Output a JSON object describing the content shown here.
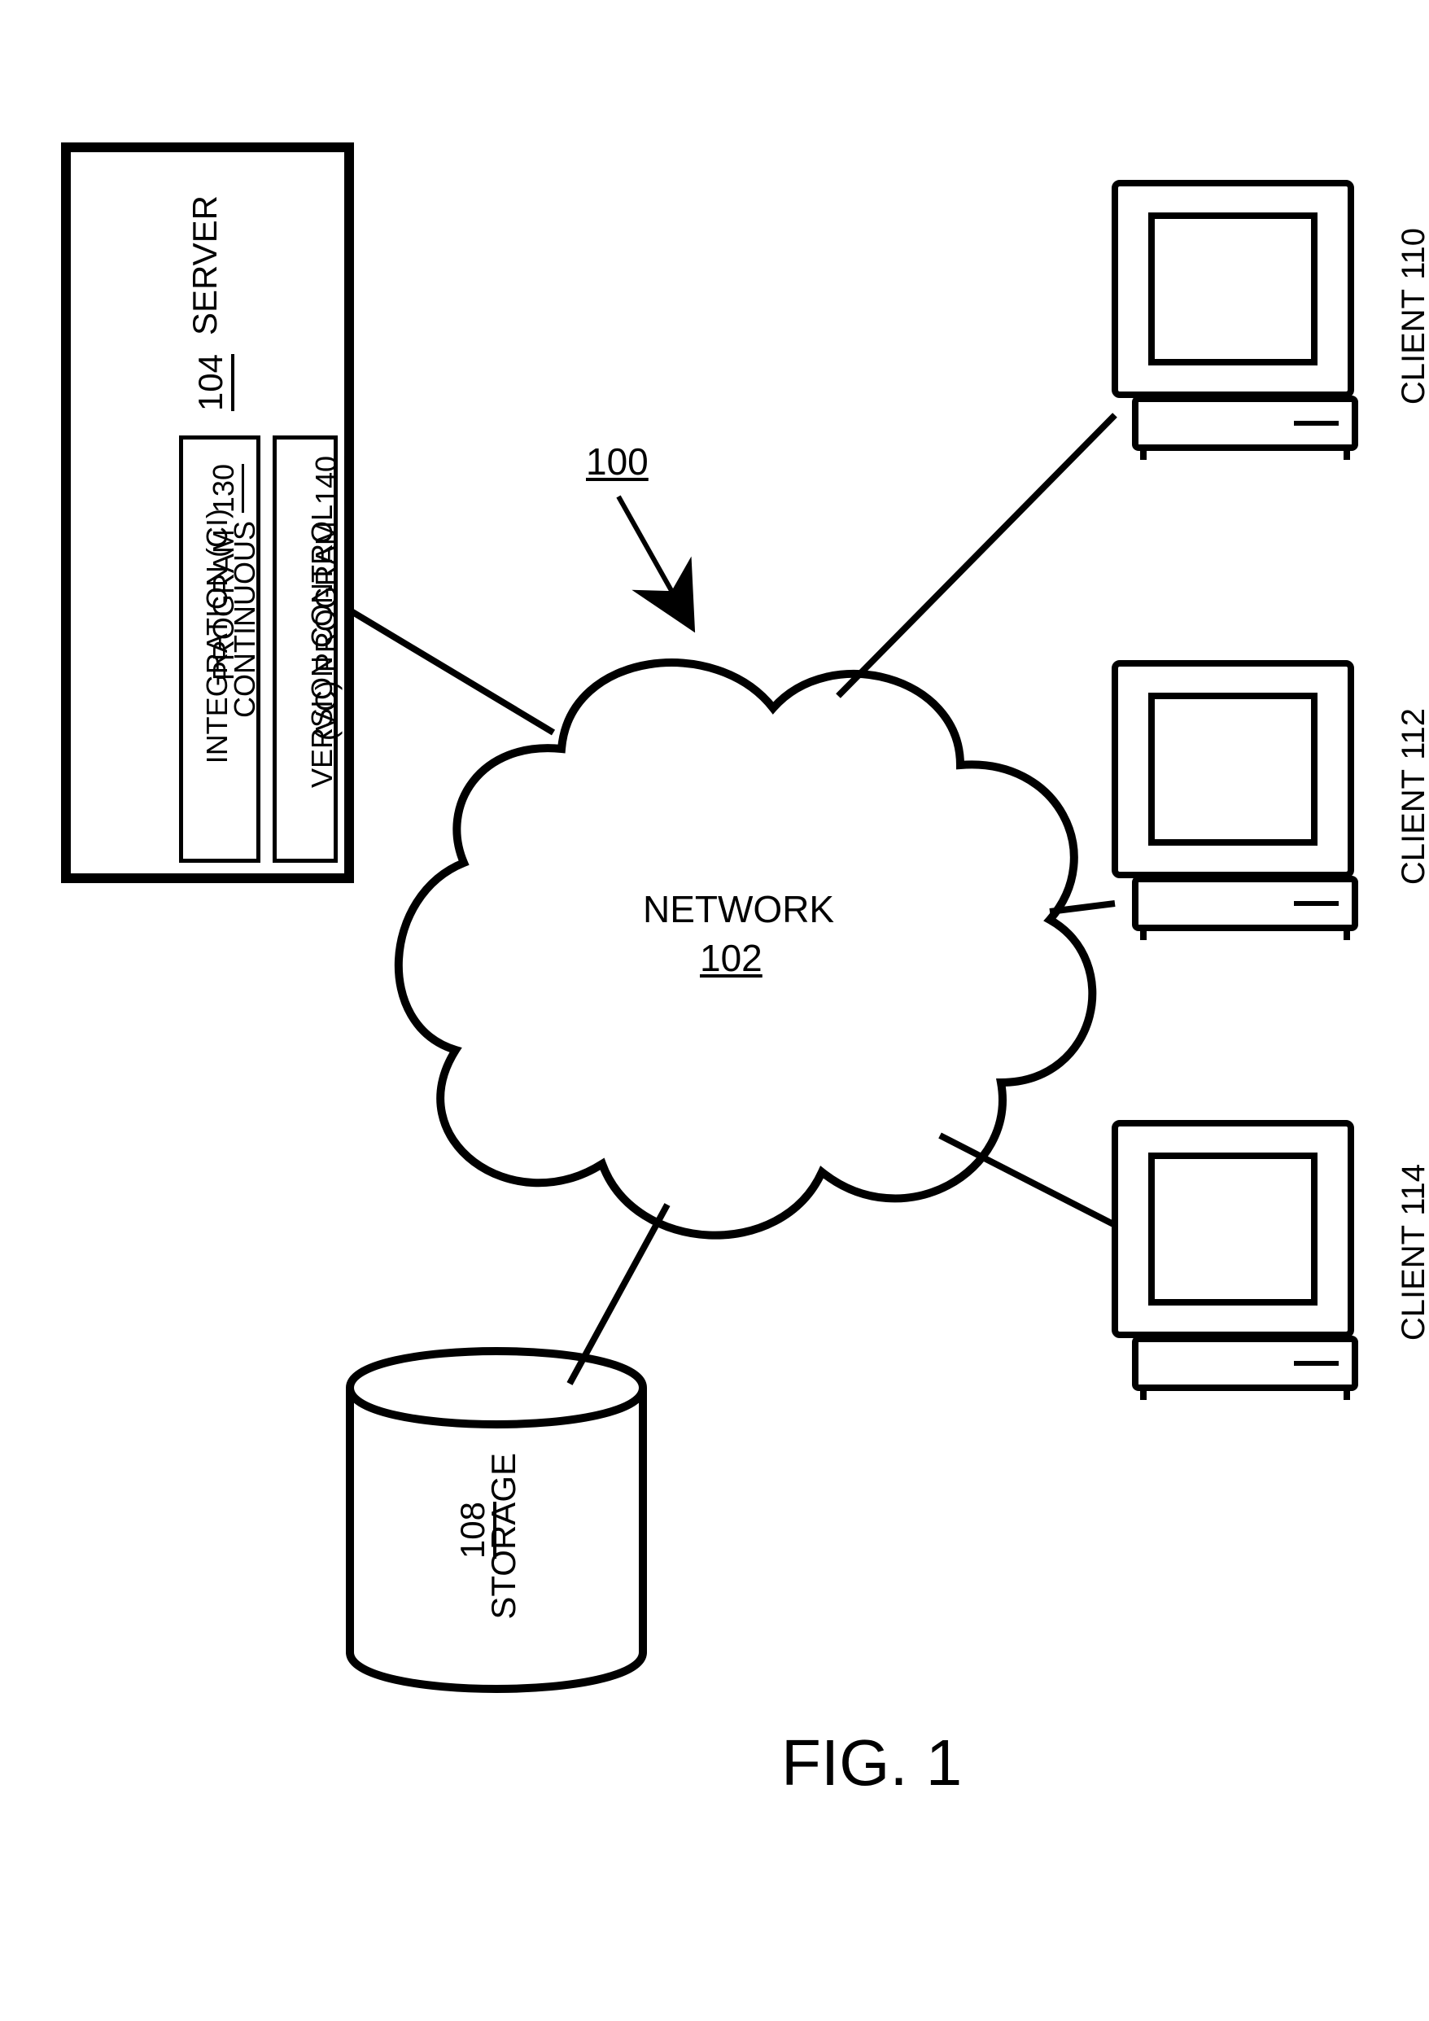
{
  "figure": {
    "ref_num": "100",
    "caption": "FIG. 1"
  },
  "network": {
    "label": "NETWORK",
    "ref": "102"
  },
  "server": {
    "label": "SERVER",
    "ref": "104",
    "ci": {
      "line1": "CONTINUOUS",
      "line2": "INTEGRATION (CI)",
      "line3_prefix": "PROGRAM",
      "ref": "130"
    },
    "vc": {
      "line1": "VERSION CONTROL",
      "line2_prefix": "(VC) PROGRAM",
      "ref": "140"
    }
  },
  "storage": {
    "label": "STORAGE",
    "ref": "108"
  },
  "clients": [
    {
      "label": "CLIENT",
      "ref": "110"
    },
    {
      "label": "CLIENT",
      "ref": "112"
    },
    {
      "label": "CLIENT",
      "ref": "114"
    }
  ]
}
